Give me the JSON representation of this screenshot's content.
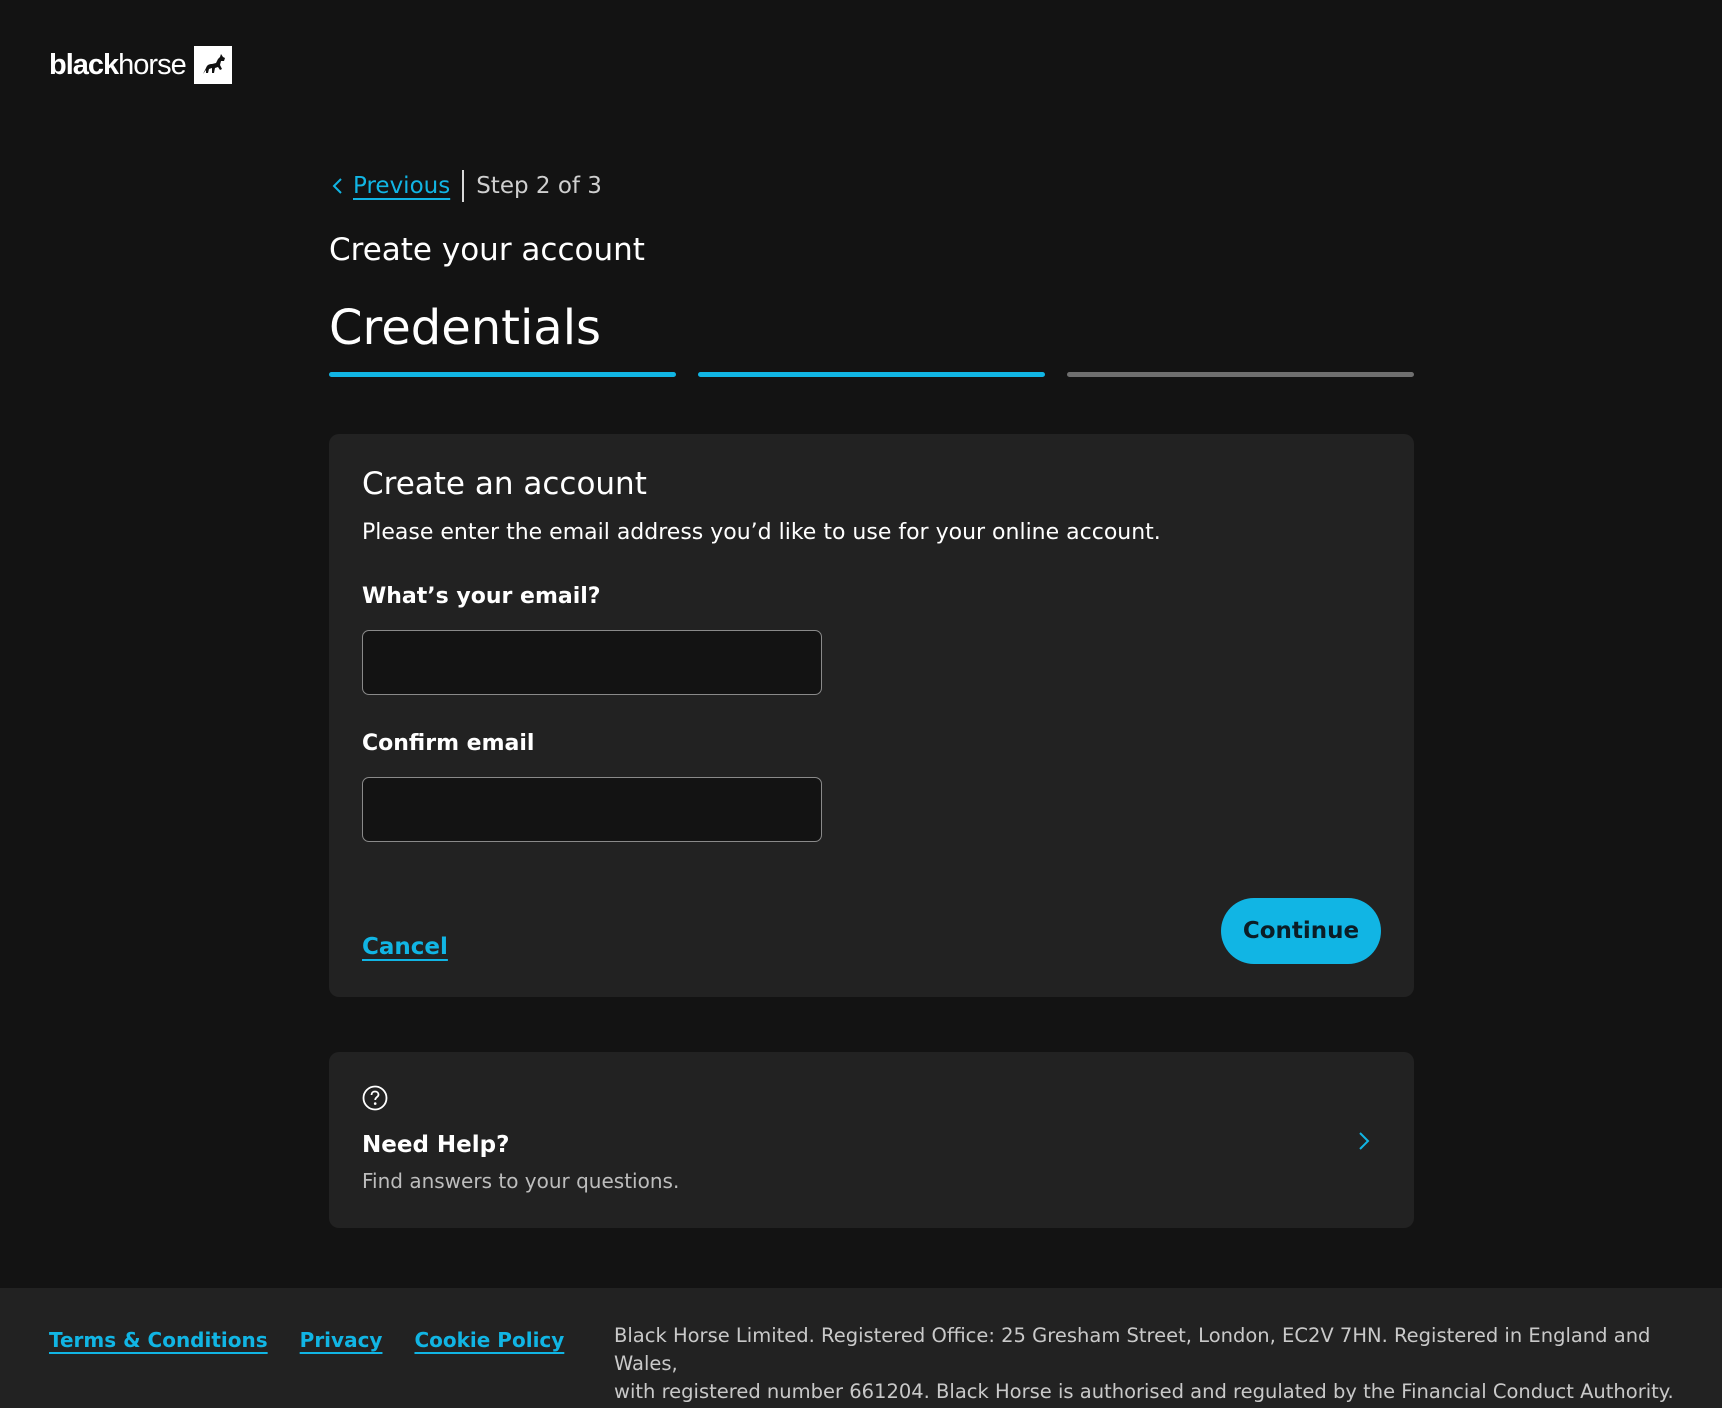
{
  "brand": {
    "name_bold": "black",
    "name_light": "horse",
    "logo_icon": "horse-icon",
    "accent_color": "#11b5e4"
  },
  "navigation": {
    "previous_label": "Previous",
    "step_text": "Step 2 of 3",
    "current_step": 2,
    "total_steps": 3
  },
  "page": {
    "subtitle": "Create your account",
    "title": "Credentials"
  },
  "form": {
    "title": "Create an account",
    "description": "Please enter the email address you’d like to use for your online account.",
    "email_label": "What’s your email?",
    "email_value": "",
    "confirm_label": "Confirm email",
    "confirm_value": "",
    "cancel_label": "Cancel",
    "continue_label": "Continue"
  },
  "help": {
    "icon": "question-circle-icon",
    "title": "Need Help?",
    "subtitle": "Find answers to your questions."
  },
  "footer": {
    "links": [
      "Terms & Conditions",
      "Privacy",
      "Cookie Policy"
    ],
    "legal_line1": "Black Horse Limited. Registered Office: 25 Gresham Street, London, EC2V 7HN. Registered in England and Wales,",
    "legal_line2": "with registered number 661204. Black Horse is authorised and regulated by the Financial Conduct Authority."
  }
}
